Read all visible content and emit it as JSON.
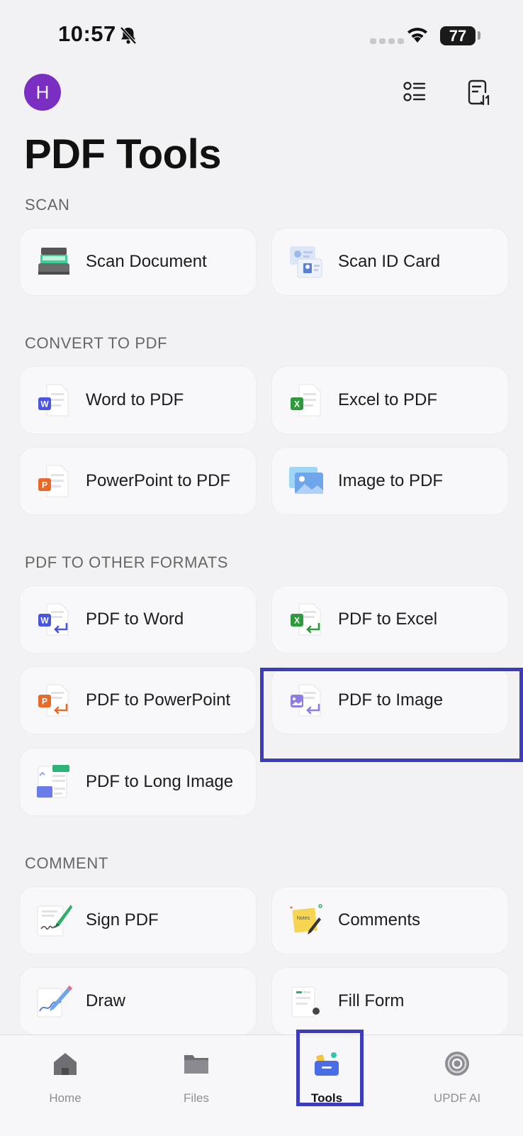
{
  "status_bar": {
    "time": "10:57",
    "battery": "77"
  },
  "header": {
    "avatar_letter": "H",
    "title": "PDF Tools"
  },
  "sections": [
    {
      "heading": "SCAN",
      "items": [
        "Scan Document",
        "Scan ID Card"
      ]
    },
    {
      "heading": "CONVERT TO PDF",
      "items": [
        "Word to PDF",
        "Excel to PDF",
        "PowerPoint to PDF",
        "Image to PDF"
      ]
    },
    {
      "heading": "PDF TO OTHER FORMATS",
      "items": [
        "PDF to Word",
        "PDF to Excel",
        "PDF to PowerPoint",
        "PDF to Image",
        "PDF to Long Image"
      ]
    },
    {
      "heading": "COMMENT",
      "items": [
        "Sign PDF",
        "Comments",
        "Draw",
        "Fill Form"
      ]
    }
  ],
  "tabbar": {
    "tabs": [
      "Home",
      "Files",
      "Tools",
      "UPDF AI"
    ],
    "active": "Tools"
  },
  "colors": {
    "accent": "#3b3dba",
    "avatar": "#7a2ec2",
    "word": "#4a56e0",
    "excel": "#2e9a3c",
    "powerpoint": "#e86a2a"
  },
  "icons": [
    "bell-off-icon",
    "wifi-icon",
    "list-view-icon",
    "sort-icon",
    "scanner-icon",
    "id-card-icon",
    "word-icon",
    "excel-icon",
    "powerpoint-icon",
    "image-icon",
    "long-image-icon",
    "signature-icon",
    "sticky-note-icon",
    "draw-icon",
    "fill-form-icon",
    "home-icon",
    "folder-icon",
    "toolbox-icon",
    "ai-icon"
  ]
}
